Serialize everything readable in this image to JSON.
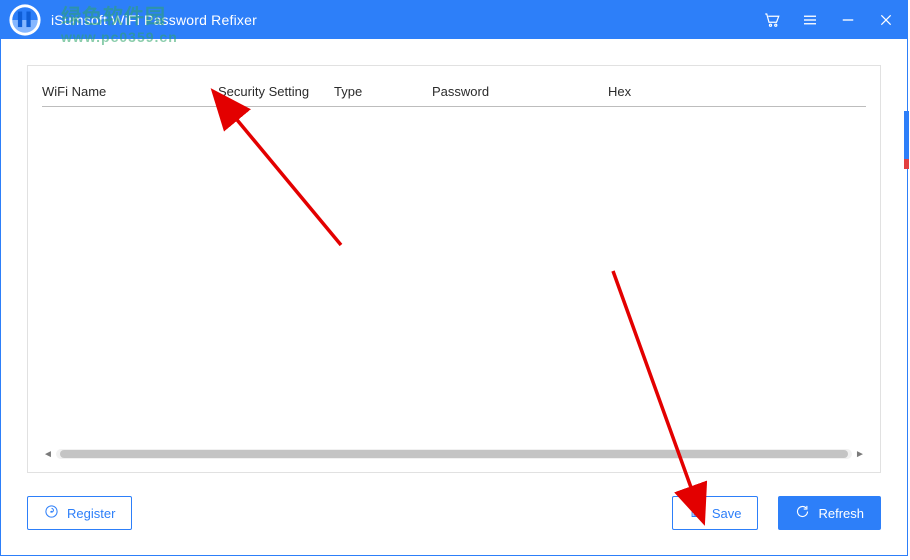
{
  "app": {
    "title": "iSumsoft WiFi Password Refixer"
  },
  "watermark": {
    "cn": "绿色软件园",
    "url": "www.pc0359.cn"
  },
  "titlebar": {
    "icons": {
      "cart": "cart-icon",
      "menu": "menu-icon",
      "minimize": "minimize-icon",
      "close": "close-icon"
    }
  },
  "columns": {
    "wifi_name": "WiFi Name",
    "security": "Security Setting",
    "type": "Type",
    "password": "Password",
    "hex": "Hex"
  },
  "rows": [],
  "footer": {
    "register": "Register",
    "save": "Save",
    "refresh": "Refresh"
  },
  "colors": {
    "accent": "#2d7ff9",
    "arrow": "#e30000"
  }
}
